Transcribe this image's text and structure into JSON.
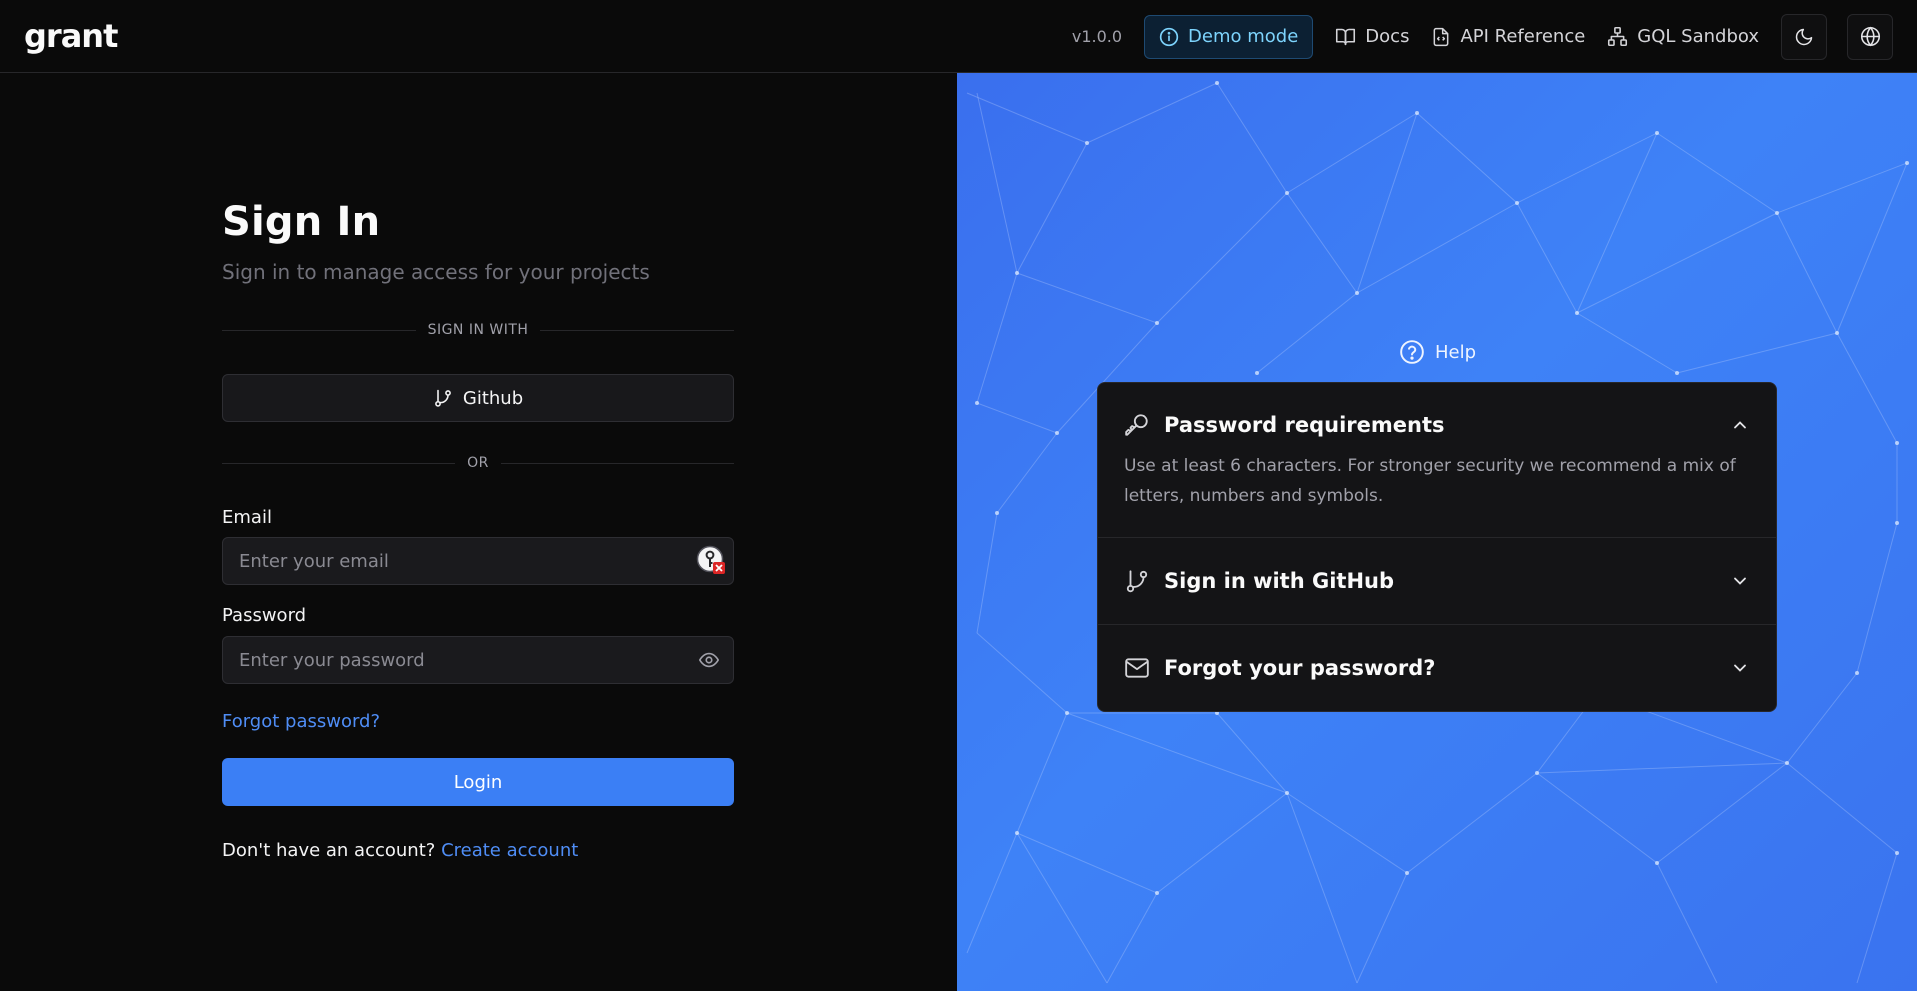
{
  "header": {
    "logo": "grant",
    "version": "v1.0.0",
    "demo_label": "Demo mode",
    "docs_label": "Docs",
    "api_label": "API Reference",
    "gql_label": "GQL Sandbox"
  },
  "signin": {
    "title": "Sign In",
    "subtitle": "Sign in to manage access for your projects",
    "sign_in_with": "SIGN IN WITH",
    "github_label": "Github",
    "or_label": "OR",
    "email_label": "Email",
    "email_placeholder": "Enter your email",
    "email_value": "",
    "password_label": "Password",
    "password_placeholder": "Enter your password",
    "password_value": "",
    "forgot_label": "Forgot password?",
    "login_label": "Login",
    "no_account_text": "Don't have an account?",
    "create_account_label": "Create account"
  },
  "help": {
    "title": "Help",
    "items": [
      {
        "title": "Password requirements",
        "icon": "key-icon",
        "expanded": true,
        "body": "Use at least 6 characters. For stronger security we recommend a mix of letters, numbers and symbols."
      },
      {
        "title": "Sign in with GitHub",
        "icon": "git-branch-icon",
        "expanded": false
      },
      {
        "title": "Forgot your password?",
        "icon": "mail-icon",
        "expanded": false
      }
    ]
  },
  "colors": {
    "accent": "#3b7ff5",
    "link": "#4f8df5",
    "background": "#0a0a0a",
    "panel_blue": "#3e82f7"
  }
}
